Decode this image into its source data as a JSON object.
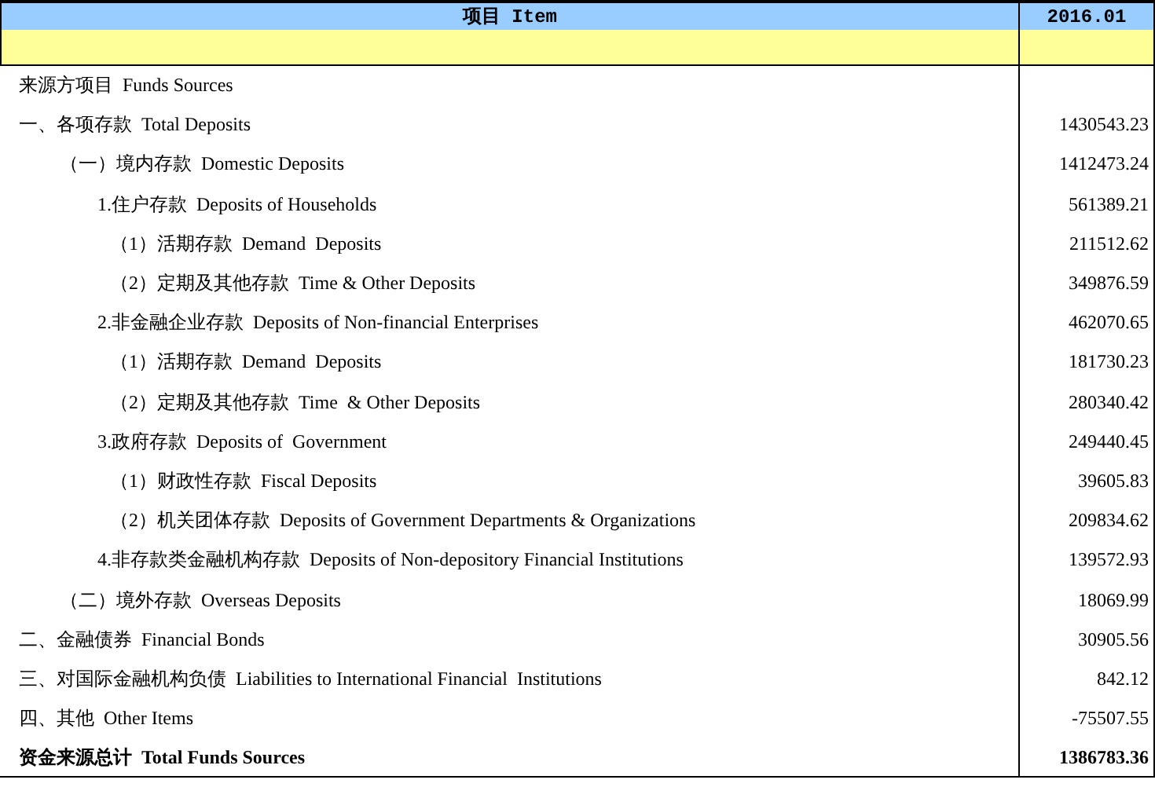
{
  "table": {
    "columns": [
      "项目 Item",
      "2016.01"
    ],
    "rows": [
      {
        "kind": "item",
        "label": "来源方项目  Funds Sources"
      },
      {
        "kind": "item",
        "label": "一、各项存款  Total Deposits",
        "value": "1430543.23",
        "children": [
          {
            "kind": "item",
            "label": "（一）境内存款  Domestic Deposits",
            "value": "1412473.24",
            "children": [
              {
                "kind": "item",
                "label": "1.住户存款  Deposits of Households",
                "value": "561389.21",
                "children": [
                  {
                    "kind": "item",
                    "label": "（1）活期存款  Demand  Deposits",
                    "value": "211512.62"
                  },
                  {
                    "kind": "item",
                    "label": "（2）定期及其他存款  Time & Other Deposits",
                    "value": "349876.59"
                  }
                ]
              },
              {
                "kind": "item",
                "label": "2.非金融企业存款  Deposits of Non-financial Enterprises",
                "value": "462070.65",
                "children": [
                  {
                    "kind": "item",
                    "label": "（1）活期存款  Demand  Deposits",
                    "value": "181730.23"
                  },
                  {
                    "kind": "item",
                    "label": "（2）定期及其他存款  Time  & Other Deposits",
                    "value": "280340.42"
                  }
                ]
              },
              {
                "kind": "item",
                "label": "3.政府存款  Deposits of  Government",
                "value": "249440.45",
                "children": [
                  {
                    "kind": "item",
                    "label": "（1）财政性存款  Fiscal Deposits",
                    "value": "39605.83"
                  },
                  {
                    "kind": "item",
                    "label": "（2）机关团体存款  Deposits of Government Departments & Organizations",
                    "value": "209834.62"
                  }
                ]
              },
              {
                "kind": "item",
                "label": "4.非存款类金融机构存款  Deposits of Non-depository Financial Institutions",
                "value": "139572.93"
              }
            ]
          },
          {
            "kind": "item",
            "label": "（二）境外存款  Overseas Deposits",
            "value": "18069.99"
          }
        ]
      },
      {
        "kind": "item",
        "label": "二、金融债券  Financial Bonds",
        "value": "30905.56"
      },
      {
        "kind": "item",
        "label": "三、对国际金融机构负债  Liabilities to International Financial  Institutions",
        "value": "842.12"
      },
      {
        "kind": "item",
        "label": "四、其他  Other Items",
        "value": "-75507.55"
      },
      {
        "kind": "total",
        "label": "资金来源总计  Total Funds Sources",
        "value": "1386783.36"
      }
    ]
  }
}
